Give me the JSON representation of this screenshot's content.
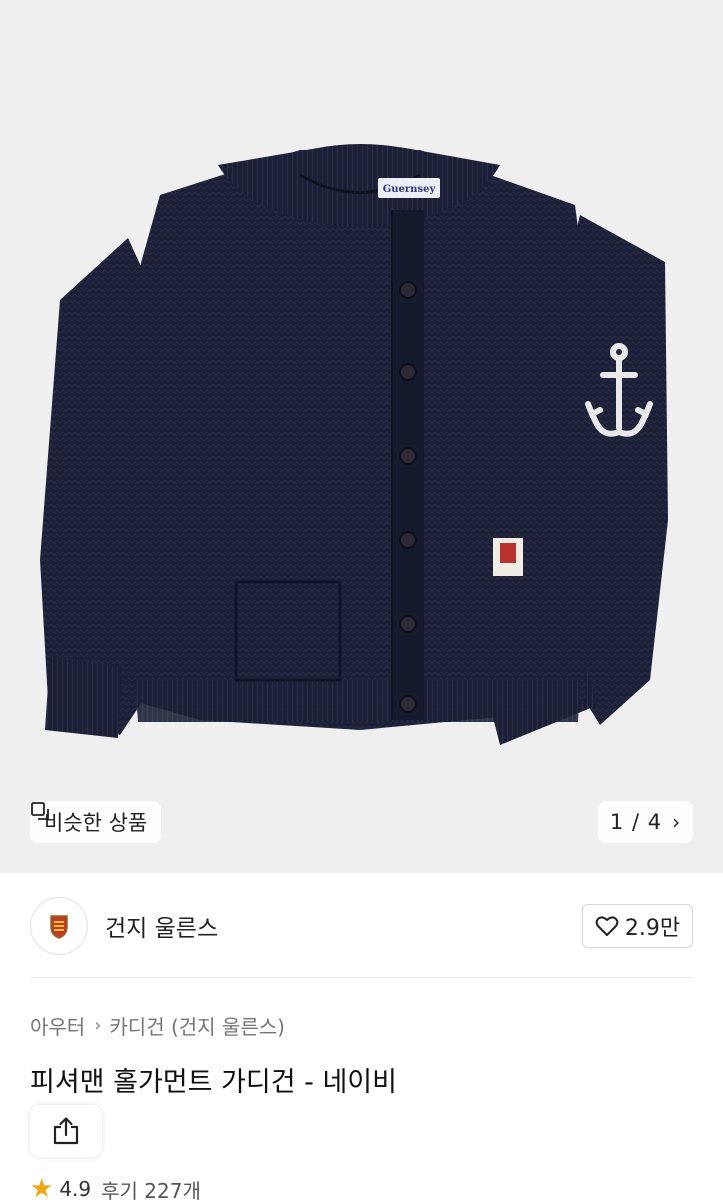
{
  "hero": {
    "similar_label": "비슷한 상품",
    "counter": "1 / 4",
    "label_text": "Guernsey"
  },
  "seller": {
    "name": "건지 울른스",
    "likes": "2.9만"
  },
  "breadcrumb": {
    "level1": "아우터",
    "level2": "카디건 (건지 울른스)"
  },
  "product": {
    "title": "피셔맨 홀가먼트 가디건 - 네이비",
    "rating": "4.9",
    "reviews": "후기 227개"
  },
  "colors": {
    "knit_navy": "#1c2138",
    "star": "#f2a614",
    "hero_bg": "#efefef"
  },
  "icons": {
    "similar": "copy-icon",
    "next": "chevron-right-icon",
    "like": "heart-icon",
    "share": "share-icon",
    "rating": "star-icon"
  }
}
